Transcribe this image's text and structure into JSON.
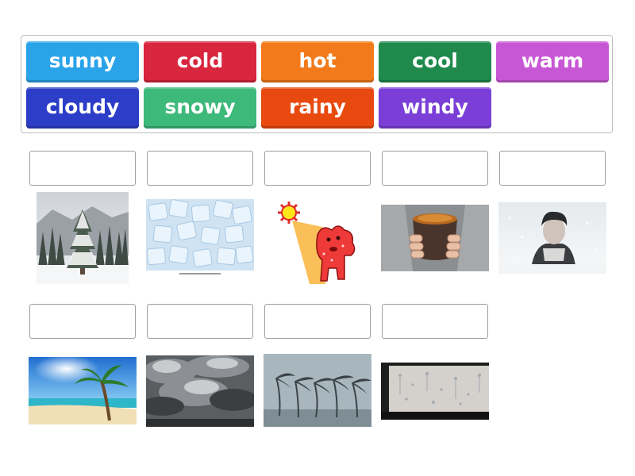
{
  "word_bank": [
    {
      "label": "sunny",
      "color": "#2aa3e8"
    },
    {
      "label": "cold",
      "color": "#d7263d"
    },
    {
      "label": "hot",
      "color": "#f27a1a"
    },
    {
      "label": "cool",
      "color": "#1f8a4c"
    },
    {
      "label": "warm",
      "color": "#c857d6"
    },
    {
      "label": "cloudy",
      "color": "#2c3ec7"
    },
    {
      "label": "snowy",
      "color": "#3db97a"
    },
    {
      "label": "rainy",
      "color": "#e8490f"
    },
    {
      "label": "windy",
      "color": "#7b3fd8"
    }
  ],
  "images": [
    {
      "name": "snowy-pine-tree-image"
    },
    {
      "name": "ice-cubes-image"
    },
    {
      "name": "hot-sun-cartoon-image"
    },
    {
      "name": "warm-tea-mug-image"
    },
    {
      "name": "freezing-man-snow-image"
    },
    {
      "name": "sunny-beach-image"
    },
    {
      "name": "storm-clouds-image"
    },
    {
      "name": "windy-palm-trees-image"
    },
    {
      "name": "rainy-window-image"
    }
  ]
}
